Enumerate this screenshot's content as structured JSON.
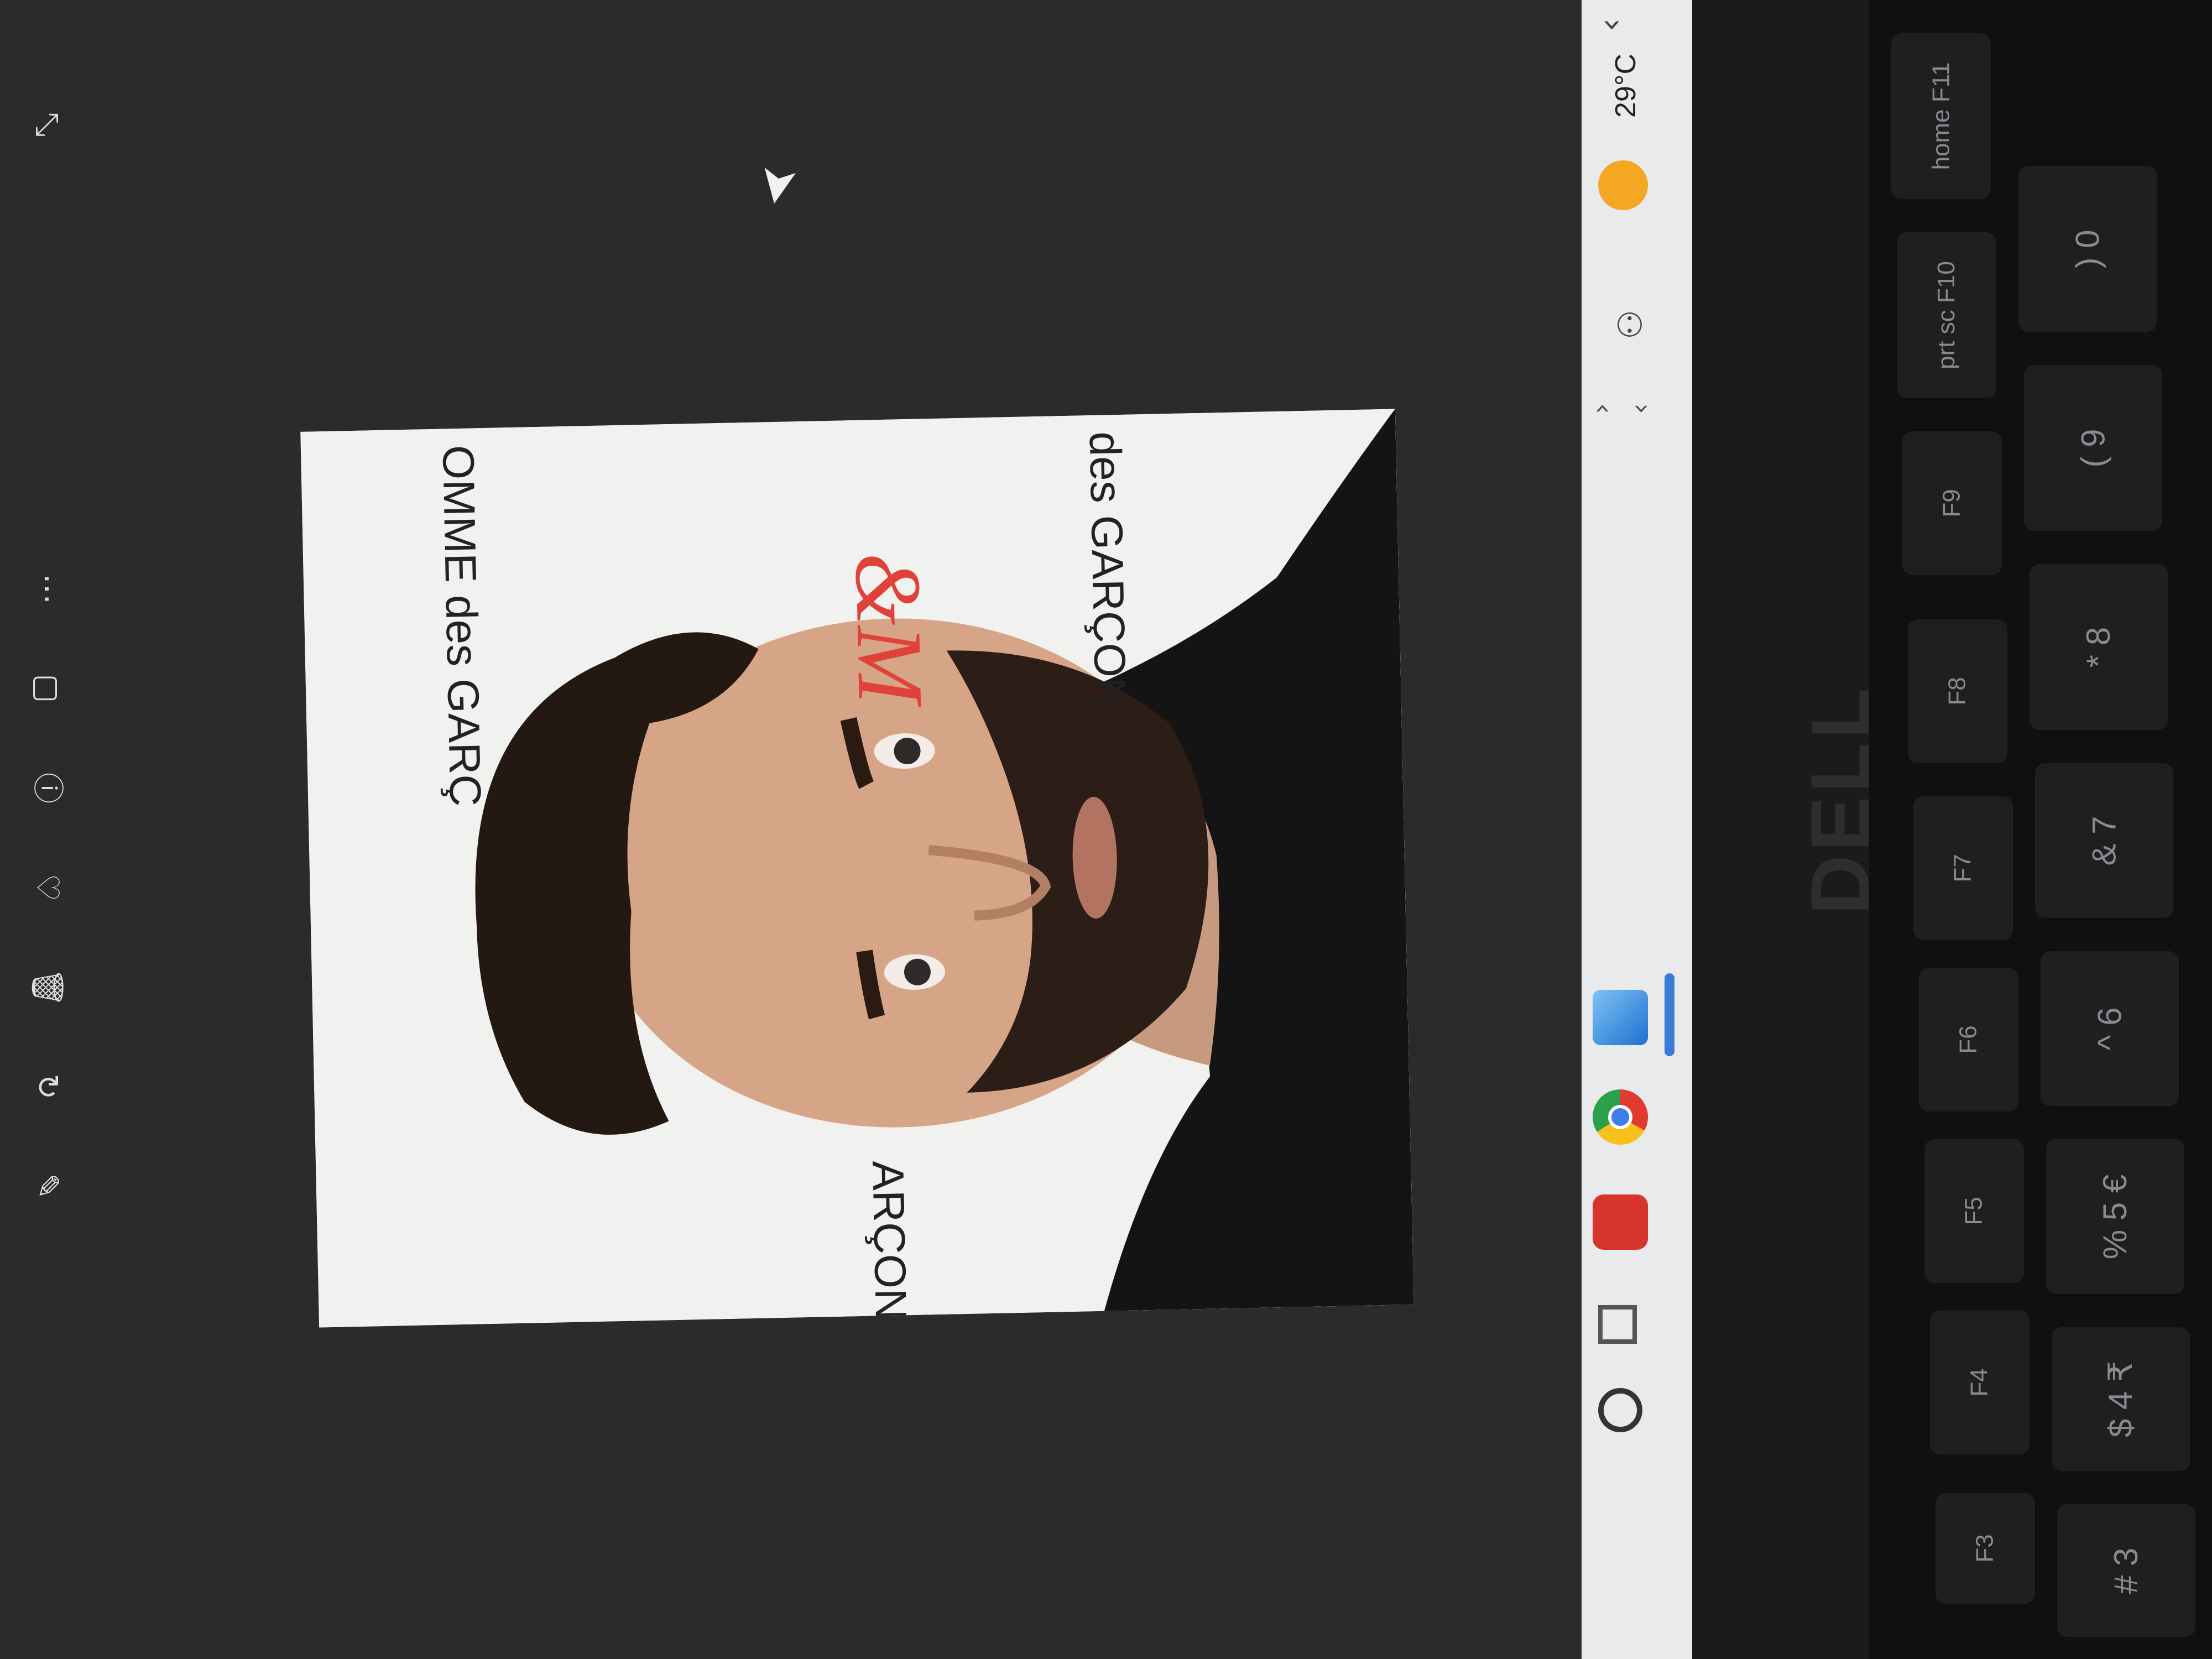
{
  "photo": {
    "backdrop_text": [
      "OMME des GARÇ",
      "des GARÇON",
      "ARÇONS"
    ],
    "logo_text": "&M"
  },
  "taskbar": {
    "weather_temp": "29°C",
    "icons": [
      "search-icon",
      "task-view-icon",
      "app-icon-red",
      "chrome-icon",
      "photos-icon",
      "people-icon",
      "chevron-left-icon",
      "chevron-right-icon",
      "weather-icon",
      "chevron-up-icon"
    ]
  },
  "laptop": {
    "brand": "DELL"
  },
  "keyboard": {
    "function_row": [
      "F3",
      "F4",
      "F5",
      "F6",
      "F7",
      "F8",
      "F9",
      "prt sc F10",
      "home F11"
    ],
    "number_row": [
      "# 3",
      "$ 4 ₹",
      "% 5 €",
      "^ 6",
      "& 7",
      "* 8",
      "( 9",
      ") 0"
    ]
  },
  "viewer_toolbar": {
    "icons": [
      "edit-image-icon",
      "rotate-icon",
      "delete-icon",
      "favorite-icon",
      "info-icon",
      "share-icon",
      "more-icon"
    ]
  }
}
